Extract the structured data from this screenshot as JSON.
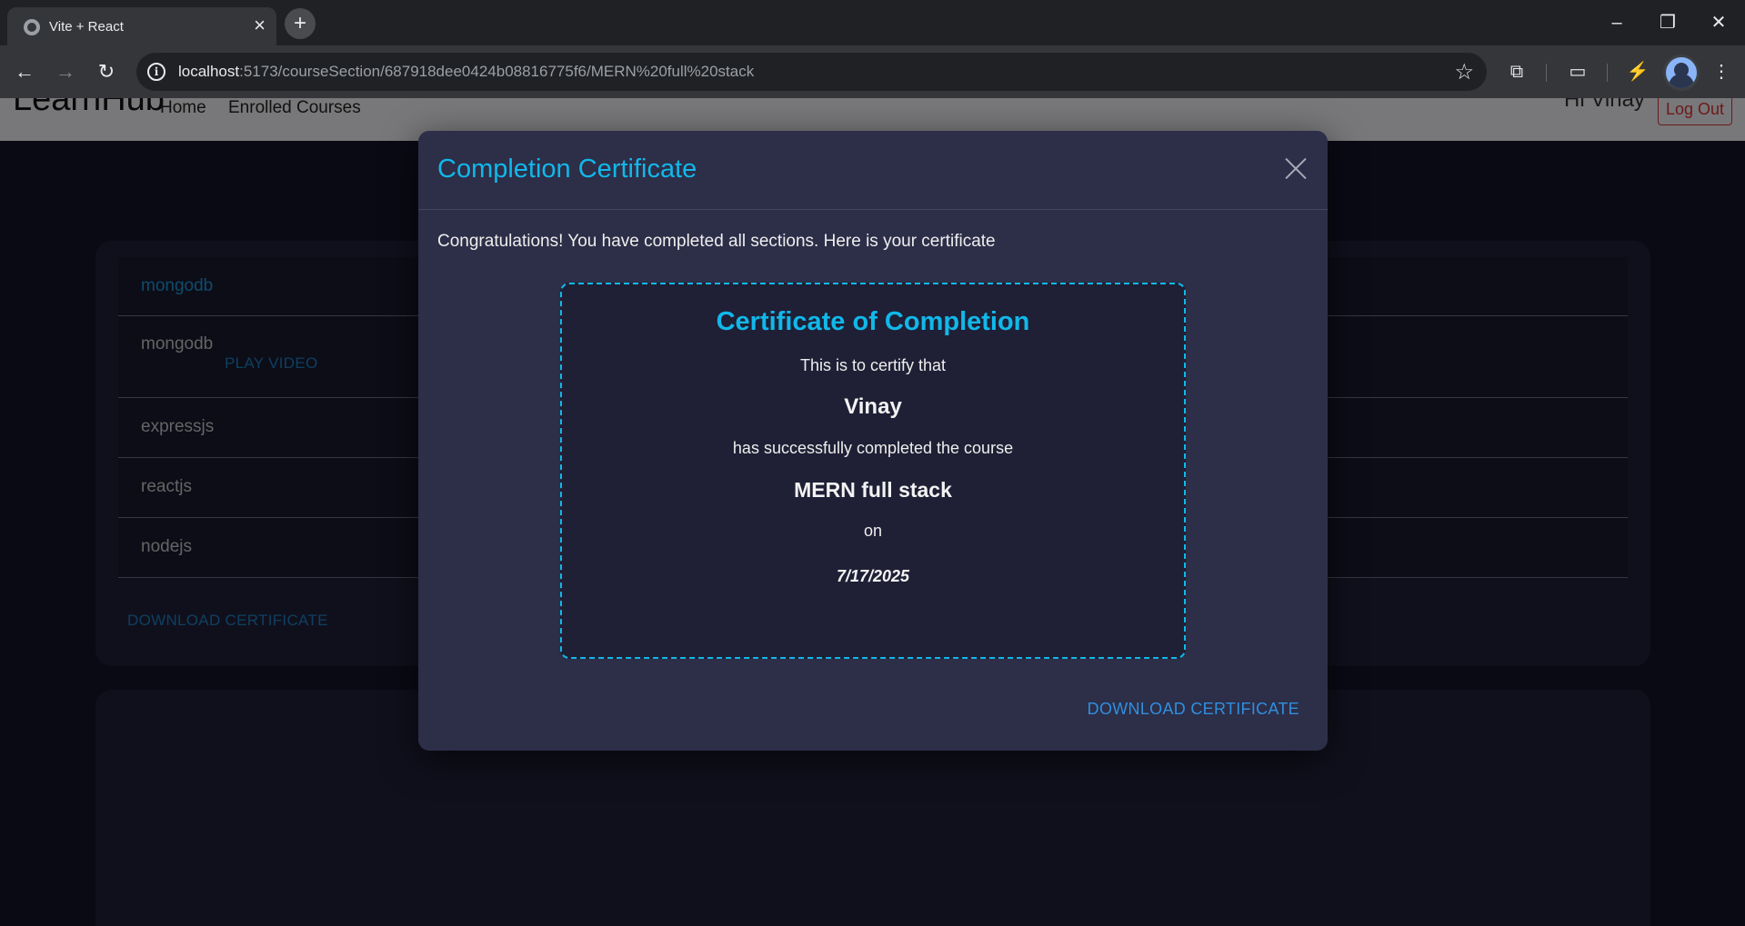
{
  "browser": {
    "tab_title": "Vite + React",
    "url_host": "localhost",
    "url_path": ":5173/courseSection/687918dee0424b08816775f6/MERN%20full%20stack"
  },
  "appnav": {
    "brand": "LearnHub",
    "links": [
      "Home",
      "Enrolled Courses"
    ],
    "greeting": "Hi Vinay",
    "logout": "Log Out"
  },
  "sections": [
    {
      "label": "mongodb",
      "active": true
    },
    {
      "label": "mongodb",
      "action": "PLAY VIDEO"
    },
    {
      "label": "expressjs"
    },
    {
      "label": "reactjs"
    },
    {
      "label": "nodejs"
    }
  ],
  "card_download": "DOWNLOAD CERTIFICATE",
  "modal": {
    "title": "Completion Certificate",
    "message": "Congratulations! You have completed all sections. Here is your certificate",
    "download": "DOWNLOAD CERTIFICATE"
  },
  "certificate": {
    "title": "Certificate of Completion",
    "line1": "This is to certify that",
    "name": "Vinay",
    "line2": "has successfully completed the course",
    "course": "MERN full stack",
    "line3": "on",
    "date": "7/17/2025"
  },
  "colors": {
    "accent": "#11b8ea",
    "link": "#1e7fc0",
    "modal_bg": "#2d2e48",
    "page_bg": "#14152a"
  }
}
